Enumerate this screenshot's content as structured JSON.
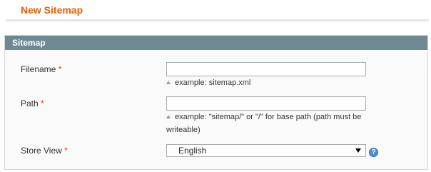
{
  "page": {
    "title": "New Sitemap"
  },
  "fieldset": {
    "legend": "Sitemap"
  },
  "fields": {
    "filename": {
      "label": "Filename",
      "required_mark": "*",
      "value": "",
      "note": "example: sitemap.xml"
    },
    "path": {
      "label": "Path",
      "required_mark": "*",
      "value": "",
      "note_line1": "example: \"sitemap/\" or \"/\" for base path (path must be",
      "note_line2": "writeable)"
    },
    "store_view": {
      "label": "Store View",
      "required_mark": "*",
      "selected": "English",
      "help_glyph": "?"
    }
  },
  "colors": {
    "title": "#eb5e00",
    "header_bar": "#6f8992",
    "required": "#eb340a",
    "help_icon": "#4d8ed6"
  },
  "icons": {
    "note_arrow": "triangle-up-icon",
    "select_arrow": "triangle-down-icon",
    "help": "help-icon"
  }
}
